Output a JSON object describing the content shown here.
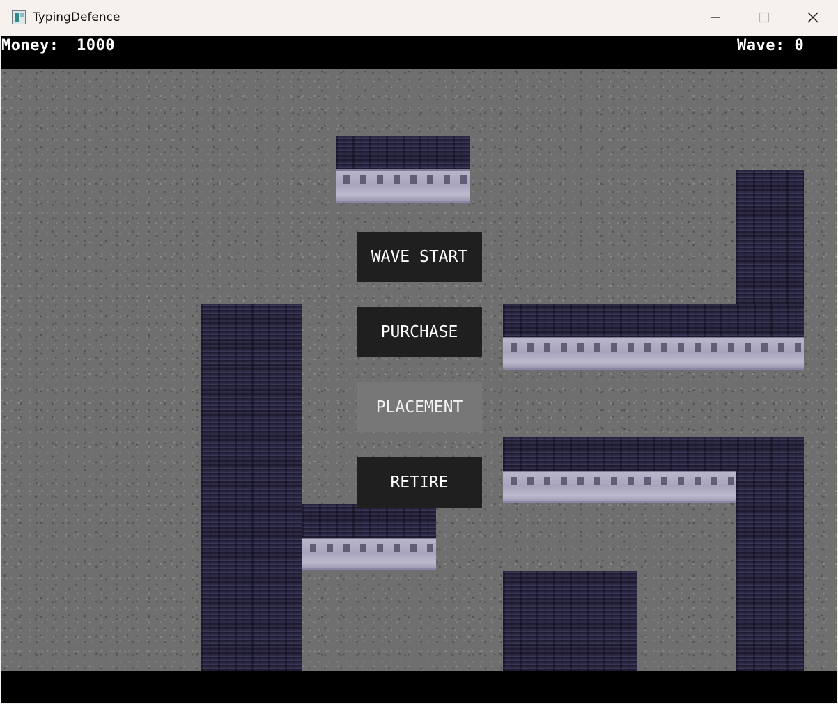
{
  "window": {
    "title": "TypingDefence",
    "controls": [
      "minimize-icon",
      "maximize-icon",
      "close-icon"
    ]
  },
  "hud": {
    "money_label": "Money:",
    "money_value": "1000",
    "wave_text": "Wave: 0"
  },
  "menu": {
    "items": [
      {
        "label": "WAVE START",
        "selected": false
      },
      {
        "label": "PURCHASE",
        "selected": false
      },
      {
        "label": "PLACEMENT",
        "selected": true
      },
      {
        "label": "RETIRE",
        "selected": false
      }
    ]
  },
  "colors": {
    "hud_background": "#000000",
    "button_background": "#1f1f1f",
    "button_selected_background": "#777777",
    "floor": "#6f6f6f",
    "wall": "#6a6784"
  }
}
